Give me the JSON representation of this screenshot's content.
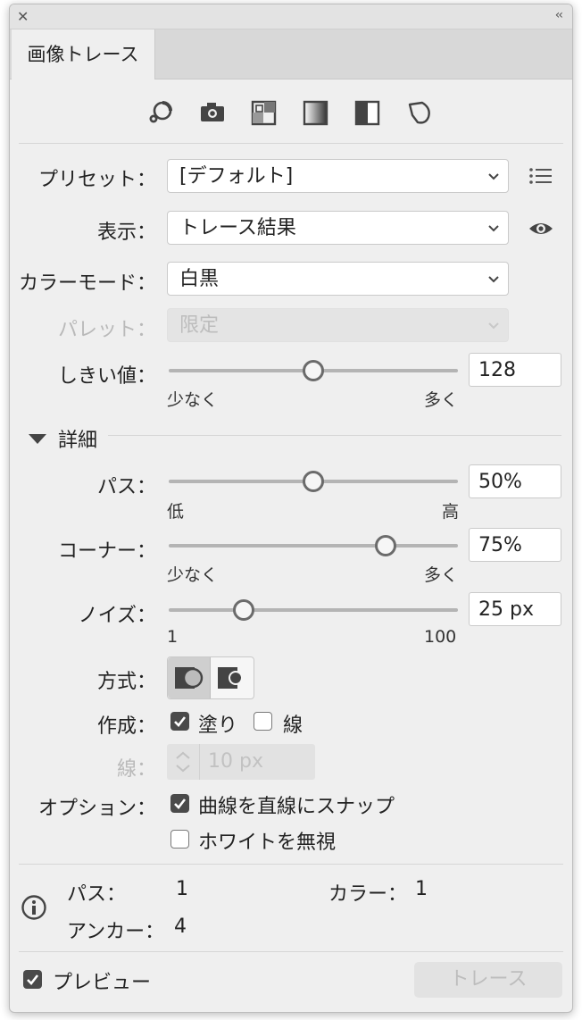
{
  "window": {
    "tab_title": "画像トレース"
  },
  "toolbar": {
    "icons": [
      "auto-color-icon",
      "high-color-icon",
      "low-color-icon",
      "grayscale-icon",
      "black-white-icon",
      "outline-icon"
    ]
  },
  "preset": {
    "label": "プリセット：",
    "value": "[デフォルト]"
  },
  "view": {
    "label": "表示：",
    "value": "トレース結果"
  },
  "mode": {
    "label": "カラーモード：",
    "value": "白黒"
  },
  "palette": {
    "label": "パレット：",
    "value": "限定"
  },
  "threshold": {
    "label": "しきい値：",
    "value": "128",
    "level": 0.5,
    "min_label": "少なく",
    "max_label": "多く"
  },
  "advanced": {
    "label": "詳細"
  },
  "paths": {
    "label": "パス：",
    "value": "50%",
    "level": 0.5,
    "min_label": "低",
    "max_label": "高"
  },
  "corners": {
    "label": "コーナー：",
    "value": "75%",
    "level": 0.75,
    "min_label": "少なく",
    "max_label": "多く"
  },
  "noise": {
    "label": "ノイズ：",
    "value": "25 px",
    "level": 0.26,
    "min_label": "1",
    "max_label": "100"
  },
  "method": {
    "label": "方式："
  },
  "create": {
    "label": "作成：",
    "fills_label": "塗り",
    "fills_checked": true,
    "strokes_label": "線",
    "strokes_checked": false
  },
  "stroke": {
    "label": "線：",
    "value": "10 px"
  },
  "options": {
    "label": "オプション：",
    "snap_label": "曲線を直線にスナップ",
    "snap_checked": true,
    "ignore_white_label": "ホワイトを無視",
    "ignore_white_checked": false
  },
  "info": {
    "paths_label": "パス：",
    "paths_value": "1",
    "colors_label": "カラー：",
    "colors_value": "1",
    "anchors_label": "アンカー：",
    "anchors_value": "4"
  },
  "footer": {
    "preview_label": "プレビュー",
    "preview_checked": true,
    "trace_label": "トレース"
  },
  "colors": {
    "panel": "#efefef",
    "field": "#ffffff",
    "accent": "#4a4a4a",
    "disabled_text": "#b9b9b9"
  }
}
